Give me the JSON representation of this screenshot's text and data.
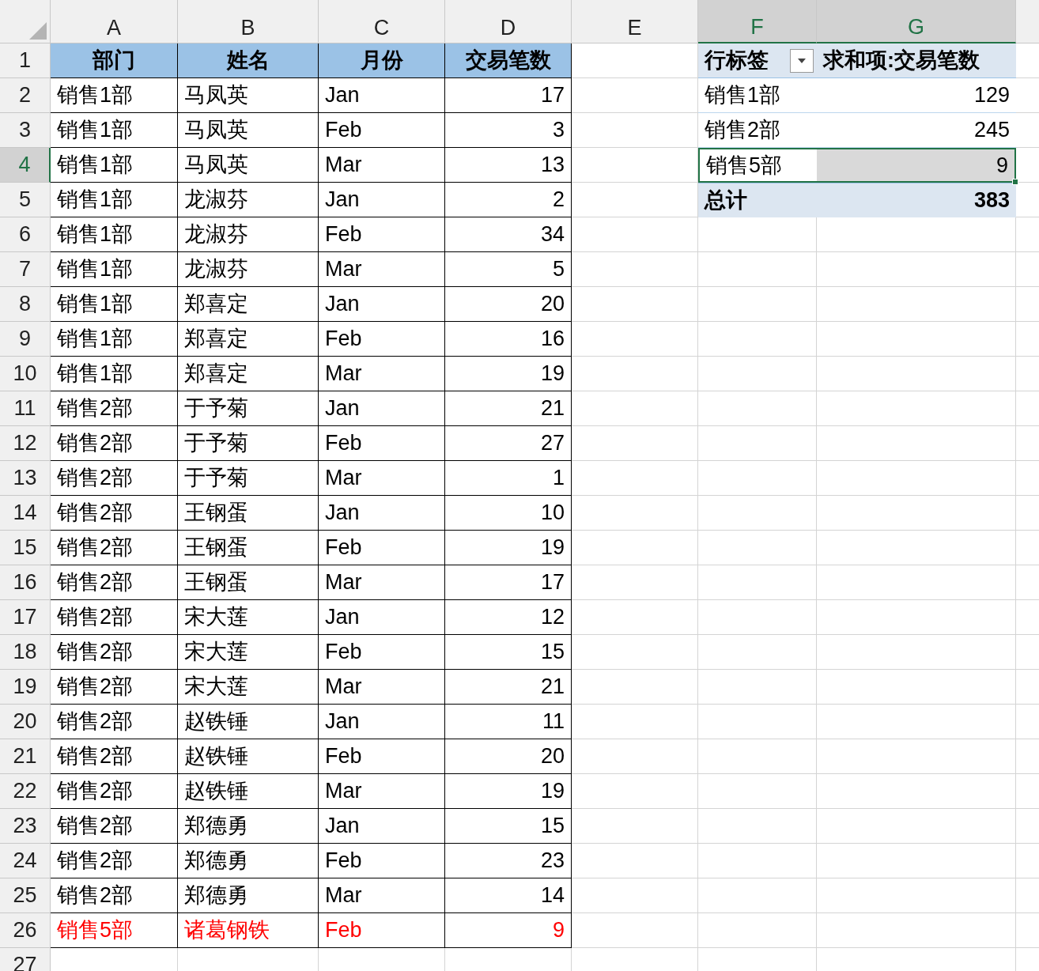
{
  "column_headers": [
    {
      "label": "A",
      "selected": false
    },
    {
      "label": "B",
      "selected": false
    },
    {
      "label": "C",
      "selected": false
    },
    {
      "label": "D",
      "selected": false
    },
    {
      "label": "E",
      "selected": false
    },
    {
      "label": "F",
      "selected": true
    },
    {
      "label": "G",
      "selected": true
    }
  ],
  "row_headers": [
    {
      "label": "1",
      "selected": false
    },
    {
      "label": "2",
      "selected": false
    },
    {
      "label": "3",
      "selected": false
    },
    {
      "label": "4",
      "selected": true
    },
    {
      "label": "5",
      "selected": false
    },
    {
      "label": "6",
      "selected": false
    },
    {
      "label": "7",
      "selected": false
    },
    {
      "label": "8",
      "selected": false
    },
    {
      "label": "9",
      "selected": false
    },
    {
      "label": "10",
      "selected": false
    },
    {
      "label": "11",
      "selected": false
    },
    {
      "label": "12",
      "selected": false
    },
    {
      "label": "13",
      "selected": false
    },
    {
      "label": "14",
      "selected": false
    },
    {
      "label": "15",
      "selected": false
    },
    {
      "label": "16",
      "selected": false
    },
    {
      "label": "17",
      "selected": false
    },
    {
      "label": "18",
      "selected": false
    },
    {
      "label": "19",
      "selected": false
    },
    {
      "label": "20",
      "selected": false
    },
    {
      "label": "21",
      "selected": false
    },
    {
      "label": "22",
      "selected": false
    },
    {
      "label": "23",
      "selected": false
    },
    {
      "label": "24",
      "selected": false
    },
    {
      "label": "25",
      "selected": false
    },
    {
      "label": "26",
      "selected": false
    },
    {
      "label": "27",
      "selected": false
    }
  ],
  "table": {
    "columns": [
      "部门",
      "姓名",
      "月份",
      "交易笔数"
    ],
    "rows": [
      {
        "cells": [
          "销售1部",
          "马凤英",
          "Jan",
          "17"
        ],
        "flagged": false
      },
      {
        "cells": [
          "销售1部",
          "马凤英",
          "Feb",
          "3"
        ],
        "flagged": false
      },
      {
        "cells": [
          "销售1部",
          "马凤英",
          "Mar",
          "13"
        ],
        "flagged": false
      },
      {
        "cells": [
          "销售1部",
          "龙淑芬",
          "Jan",
          "2"
        ],
        "flagged": false
      },
      {
        "cells": [
          "销售1部",
          "龙淑芬",
          "Feb",
          "34"
        ],
        "flagged": false
      },
      {
        "cells": [
          "销售1部",
          "龙淑芬",
          "Mar",
          "5"
        ],
        "flagged": false
      },
      {
        "cells": [
          "销售1部",
          "郑喜定",
          "Jan",
          "20"
        ],
        "flagged": false
      },
      {
        "cells": [
          "销售1部",
          "郑喜定",
          "Feb",
          "16"
        ],
        "flagged": false
      },
      {
        "cells": [
          "销售1部",
          "郑喜定",
          "Mar",
          "19"
        ],
        "flagged": false
      },
      {
        "cells": [
          "销售2部",
          "于予菊",
          "Jan",
          "21"
        ],
        "flagged": false
      },
      {
        "cells": [
          "销售2部",
          "于予菊",
          "Feb",
          "27"
        ],
        "flagged": false
      },
      {
        "cells": [
          "销售2部",
          "于予菊",
          "Mar",
          "1"
        ],
        "flagged": false
      },
      {
        "cells": [
          "销售2部",
          "王钢蛋",
          "Jan",
          "10"
        ],
        "flagged": false
      },
      {
        "cells": [
          "销售2部",
          "王钢蛋",
          "Feb",
          "19"
        ],
        "flagged": false
      },
      {
        "cells": [
          "销售2部",
          "王钢蛋",
          "Mar",
          "17"
        ],
        "flagged": false
      },
      {
        "cells": [
          "销售2部",
          "宋大莲",
          "Jan",
          "12"
        ],
        "flagged": false
      },
      {
        "cells": [
          "销售2部",
          "宋大莲",
          "Feb",
          "15"
        ],
        "flagged": false
      },
      {
        "cells": [
          "销售2部",
          "宋大莲",
          "Mar",
          "21"
        ],
        "flagged": false
      },
      {
        "cells": [
          "销售2部",
          "赵铁锤",
          "Jan",
          "11"
        ],
        "flagged": false
      },
      {
        "cells": [
          "销售2部",
          "赵铁锤",
          "Feb",
          "20"
        ],
        "flagged": false
      },
      {
        "cells": [
          "销售2部",
          "赵铁锤",
          "Mar",
          "19"
        ],
        "flagged": false
      },
      {
        "cells": [
          "销售2部",
          "郑德勇",
          "Jan",
          "15"
        ],
        "flagged": false
      },
      {
        "cells": [
          "销售2部",
          "郑德勇",
          "Feb",
          "23"
        ],
        "flagged": false
      },
      {
        "cells": [
          "销售2部",
          "郑德勇",
          "Mar",
          "14"
        ],
        "flagged": false
      },
      {
        "cells": [
          "销售5部",
          "诸葛钢铁",
          "Feb",
          "9"
        ],
        "flagged": true
      }
    ]
  },
  "pivot": {
    "header": {
      "label": "行标签",
      "value": "求和项:交易笔数"
    },
    "rows": [
      {
        "label": "销售1部",
        "value": "129",
        "selected": false
      },
      {
        "label": "销售2部",
        "value": "245",
        "selected": false
      },
      {
        "label": "销售5部",
        "value": "9",
        "selected": true
      }
    ],
    "total": {
      "label": "总计",
      "value": "383"
    }
  }
}
